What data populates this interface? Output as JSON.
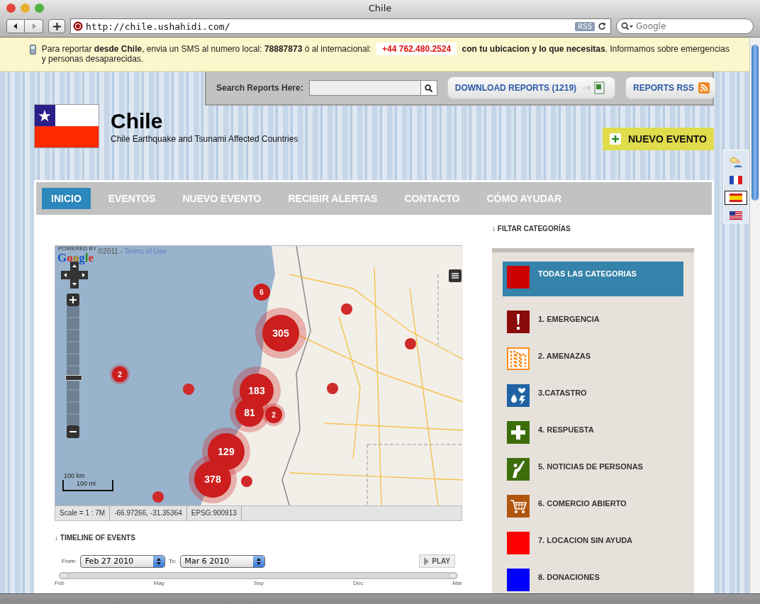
{
  "window": {
    "title": "Chile"
  },
  "toolbar": {
    "url": "http://chile.ushahidi.com/",
    "rss_badge": "RSS",
    "search_placeholder": "Google"
  },
  "banner": {
    "before": "Para reportar **desde Chile**, envia un SMS al numero local: **78887873** ó al internacional:",
    "phone": "+44 762.480.2524",
    "after": "**con tu ubicacion y lo que necesitas**. Informamos sobre emergencias y personas desaparecidas."
  },
  "search": {
    "label": "Search Reports Here:"
  },
  "download_button": "DOWNLOAD REPORTS (1219)",
  "rss_button": "REPORTS RSS",
  "site": {
    "title": "Chile",
    "subtitle": "Chile Earthquake and Tsunami Affected Countries"
  },
  "new_event_button": "NUEVO EVENTO",
  "languages": [
    {
      "kind": "people",
      "selected": false
    },
    {
      "kind": "france",
      "selected": false
    },
    {
      "kind": "spain",
      "selected": true
    },
    {
      "kind": "usa",
      "selected": false
    }
  ],
  "nav": [
    {
      "label": "INICIO",
      "selected": true
    },
    {
      "label": "EVENTOS",
      "selected": false
    },
    {
      "label": "NUEVO EVENTO",
      "selected": false
    },
    {
      "label": "RECIBIR ALERTAS",
      "selected": false
    },
    {
      "label": "CONTACTO",
      "selected": false
    },
    {
      "label": "CÓMO AYUDAR",
      "selected": false
    }
  ],
  "map": {
    "powered_by": "POWERED BY",
    "logo": "Google",
    "attribution": "©2011 -",
    "terms_link": "Terms of Use",
    "zoom": {
      "level": 0.4
    },
    "scale_km": "100 km",
    "scale_mi": "100 mi",
    "markers": [
      {
        "kind": "cluster",
        "count": "6"
      },
      {
        "kind": "cluster",
        "count": "305"
      },
      {
        "kind": "cluster",
        "count": "2"
      },
      {
        "kind": "point"
      },
      {
        "kind": "cluster",
        "count": "183"
      },
      {
        "kind": "cluster",
        "count": "81"
      },
      {
        "kind": "cluster",
        "count": "2"
      },
      {
        "kind": "cluster",
        "count": "129"
      },
      {
        "kind": "cluster",
        "count": "378"
      },
      {
        "kind": "point"
      },
      {
        "kind": "point"
      },
      {
        "kind": "point"
      },
      {
        "kind": "point"
      },
      {
        "kind": "point"
      }
    ],
    "status": [
      "Scale = 1 : 7M",
      "-66.97266, -31.35364",
      "EPSG:900913"
    ]
  },
  "timeline": {
    "heading": "↓ TIMELINE OF EVENTS",
    "from_label": "From:",
    "from": "Feb 27 2010",
    "to_label": "To:",
    "to": "Mar 6 2010",
    "play": "PLAY",
    "range": {
      "level": 1
    },
    "ticks": [
      "Feb",
      "May",
      "Sep",
      "Dec",
      "Mar"
    ]
  },
  "categories": {
    "heading": "↓ FILTAR CATEGORÍAS",
    "items": [
      {
        "label": "TODAS LAS CATEGORIAS",
        "kind": "swatch",
        "color": "#cc0000",
        "selected": true
      },
      {
        "label": "1. EMERGENCIA",
        "kind": "exclamation",
        "color": "#8b0a0a",
        "selected": false
      },
      {
        "label": "2. AMENAZAS",
        "kind": "buildings",
        "color": "#ff8c1a",
        "selected": false
      },
      {
        "label": "3.CATASTRO",
        "kind": "drops",
        "color": "#1f63a3",
        "selected": false
      },
      {
        "label": "4. RESPUESTA",
        "kind": "plus",
        "color": "#3d6e0c",
        "selected": false
      },
      {
        "label": "5. NOTICIAS DE PERSONAS",
        "kind": "person",
        "color": "#3d6e0c",
        "selected": false
      },
      {
        "label": "6. COMERCIO ABIERTO",
        "kind": "cart",
        "color": "#b0560f",
        "selected": false
      },
      {
        "label": "7. LOCACION SIN AYUDA",
        "kind": "swatch",
        "color": "#ff0000",
        "selected": false
      },
      {
        "label": "8. DONACIONES",
        "kind": "swatch",
        "color": "#0000ff",
        "selected": false
      }
    ]
  }
}
